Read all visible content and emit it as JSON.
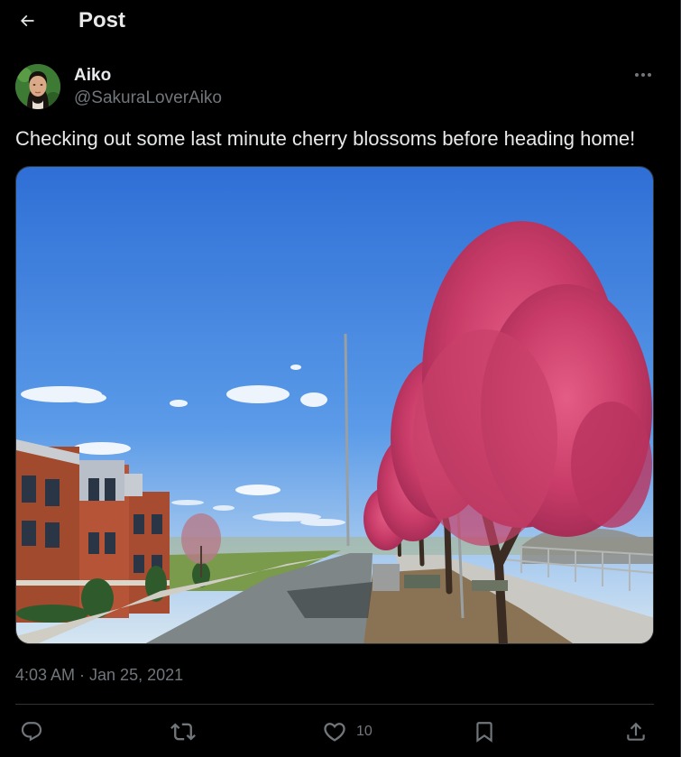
{
  "header": {
    "title": "Post",
    "back_icon": "arrow-left-icon"
  },
  "author": {
    "name": "Aiko",
    "handle": "@SakuraLoverAiko"
  },
  "tweet": {
    "text": "Checking out some last minute cherry blossoms before heading home!",
    "timestamp": "4:03 AM · Jan 25, 2021"
  },
  "actions": {
    "reply_icon": "reply-icon",
    "repost_icon": "repost-icon",
    "like_icon": "heart-icon",
    "like_count": "10",
    "bookmark_icon": "bookmark-icon",
    "share_icon": "share-icon"
  },
  "colors": {
    "background": "#000000",
    "text_primary": "#e7e9ea",
    "text_secondary": "#71767b",
    "divider": "#2f3336"
  }
}
